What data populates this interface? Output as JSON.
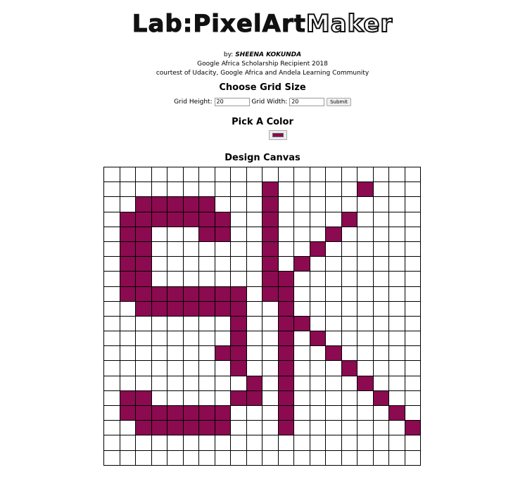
{
  "header": {
    "title_prefix": "Lab:",
    "title_main": "PixelArt",
    "title_suffix": "Maker"
  },
  "byline": {
    "by_label": "by:",
    "author": "SHEENA KOKUNDA",
    "line2": "Google Africa Scholarship Recipient 2018",
    "line3": "courtest of Udacity, Google Africa and Andela Learning Community"
  },
  "grid_size": {
    "heading": "Choose Grid Size",
    "height_label": "Grid Height:",
    "height_value": "20",
    "width_label": "Grid Width:",
    "width_value": "20",
    "submit_label": "Submit"
  },
  "color": {
    "heading": "Pick A Color",
    "selected": "#8b0a50"
  },
  "canvas": {
    "heading": "Design Canvas",
    "rows": 20,
    "cols": 20,
    "fill_color": "#8b0a50",
    "painted": [
      "....................",
      "..........#.....#...",
      "..#####...#.........",
      ".#######..#....#....",
      ".##...##..#...#.....",
      ".##.......#..#......",
      ".##.......#.#.......",
      ".##.......##........",
      ".########.##........",
      "..#######..#........",
      "........#..##.......",
      "........#..#.#......",
      ".......##..#..#.....",
      "........#..#...#....",
      ".........#.#....#...",
      ".##.....##.#.....#..",
      ".#######...#......#.",
      "..######...#.......#",
      "....................",
      "...................."
    ]
  }
}
